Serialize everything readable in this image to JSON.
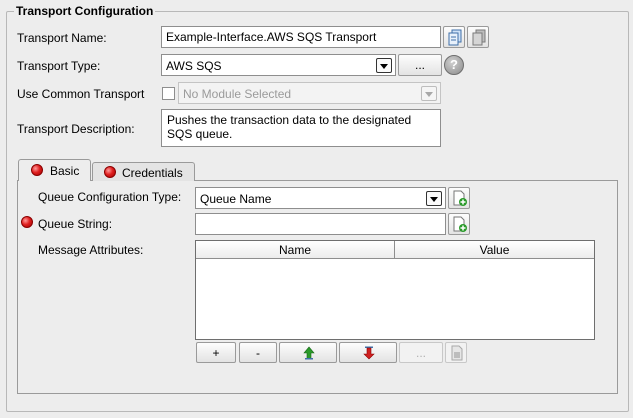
{
  "group": {
    "title": "Transport Configuration"
  },
  "transport_name": {
    "label": "Transport Name:",
    "value": "Example-Interface.AWS SQS Transport"
  },
  "transport_type": {
    "label": "Transport Type:",
    "value": "AWS SQS",
    "browse_label": "..."
  },
  "common_transport": {
    "label": "Use Common Transport",
    "checked": false,
    "value": "No Module Selected"
  },
  "description": {
    "label": "Transport Description:",
    "value_line1": "Pushes the transaction data to the designated",
    "value_line2": "SQS queue."
  },
  "tabs": [
    {
      "label": "Basic",
      "active": true,
      "status": "error"
    },
    {
      "label": "Credentials",
      "active": false,
      "status": "error"
    }
  ],
  "basic": {
    "queue_config_type": {
      "label": "Queue Configuration Type:",
      "value": "Queue Name"
    },
    "queue_string": {
      "label": "Queue String:",
      "value": "",
      "status": "error"
    },
    "message_attributes": {
      "label": "Message Attributes:",
      "columns": [
        "Name",
        "Value"
      ],
      "rows": []
    },
    "buttons": {
      "add": "+",
      "remove": "-",
      "more": "..."
    }
  },
  "icons": {
    "copy": "copy-icon",
    "paste": "paste-icon",
    "help": "help-icon",
    "add_document": "add-document-icon",
    "move_up": "arrow-up-icon",
    "move_down": "arrow-down-icon",
    "edit": "edit-document-icon"
  },
  "colors": {
    "error_dot": "#e02020",
    "add_icon_green": "#2a9a2a"
  }
}
